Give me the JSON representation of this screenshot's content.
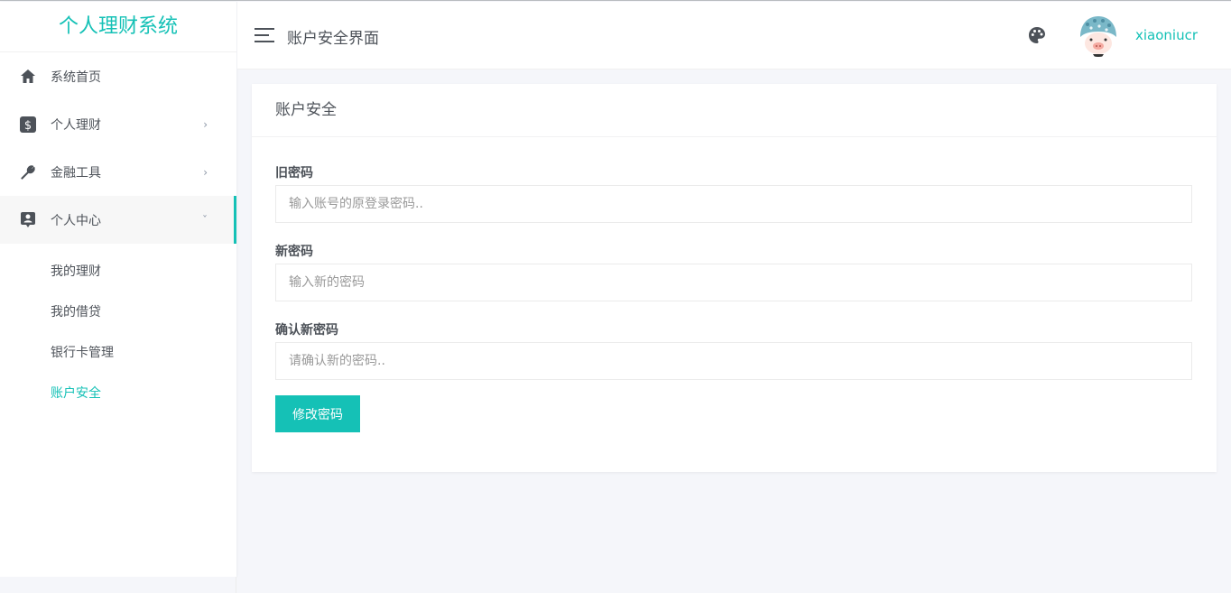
{
  "app": {
    "title": "个人理财系统"
  },
  "sidebar": {
    "items": [
      {
        "label": "系统首页",
        "icon": "home-icon",
        "arrow": ""
      },
      {
        "label": "个人理财",
        "icon": "dollar-icon",
        "arrow": "›"
      },
      {
        "label": "金融工具",
        "icon": "wrench-icon",
        "arrow": "›"
      },
      {
        "label": "个人中心",
        "icon": "account-box-icon",
        "arrow": "ˇ"
      }
    ],
    "sub_items": [
      {
        "label": "我的理财"
      },
      {
        "label": "我的借贷"
      },
      {
        "label": "银行卡管理"
      },
      {
        "label": "账户安全"
      }
    ],
    "active_sub_index": 3
  },
  "header": {
    "title": "账户安全界面",
    "username": "xiaoniucr"
  },
  "card": {
    "title": "账户安全",
    "fields": [
      {
        "label": "旧密码",
        "placeholder": "输入账号的原登录密码.."
      },
      {
        "label": "新密码",
        "placeholder": "输入新的密码"
      },
      {
        "label": "确认新密码",
        "placeholder": "请确认新的密码.."
      }
    ],
    "submit_label": "修改密码"
  },
  "colors": {
    "accent": "#15c1b6",
    "text": "#4d5259",
    "background": "#f5f6fa"
  }
}
